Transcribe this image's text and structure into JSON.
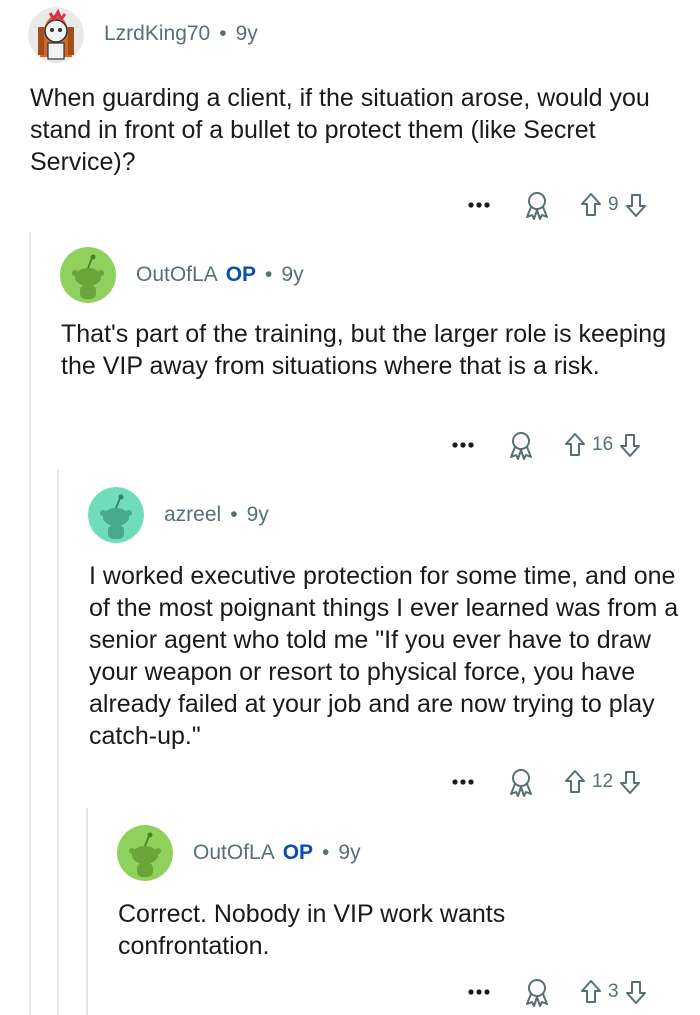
{
  "comments": [
    {
      "username": "LzrdKing70",
      "op_badge": "",
      "dot": "•",
      "age": "9y",
      "body": "When guarding a client, if the situation arose, would you stand in front of a bullet to protect them (like Secret Service)?",
      "score": "9",
      "avatar_icon": "cartoon-avatar-icon"
    },
    {
      "username": "OutOfLA",
      "op_badge": "OP",
      "dot": "•",
      "age": "9y",
      "body": "That's part of the training, but the larger role is keeping the VIP away from situations where that is a risk.",
      "score": "16",
      "avatar_icon": "snoo-avatar-icon"
    },
    {
      "username": "azreel",
      "op_badge": "",
      "dot": "•",
      "age": "9y",
      "body": "I worked executive protection for some time, and one of the most poignant things I ever learned was from a senior agent who told me \"If you ever have to draw your weapon or resort to physical force, you have already failed at your job and are now trying to play catch-up.\"",
      "score": "12",
      "avatar_icon": "snoo-avatar-icon"
    },
    {
      "username": "OutOfLA",
      "op_badge": "OP",
      "dot": "•",
      "age": "9y",
      "body": "Correct. Nobody in VIP work wants confrontation.",
      "score": "3",
      "avatar_icon": "snoo-avatar-icon"
    }
  ],
  "icons": {
    "more": "more-options-icon",
    "award": "award-icon",
    "upvote": "upvote-arrow-icon",
    "downvote": "downvote-arrow-icon"
  },
  "colors": {
    "meta_gray": "#576f76",
    "op_blue": "#0a4fb0",
    "snoo_green": "#8fd15c",
    "snoo_teal": "#6fdcbc",
    "thread_line": "#e6e6e8"
  }
}
